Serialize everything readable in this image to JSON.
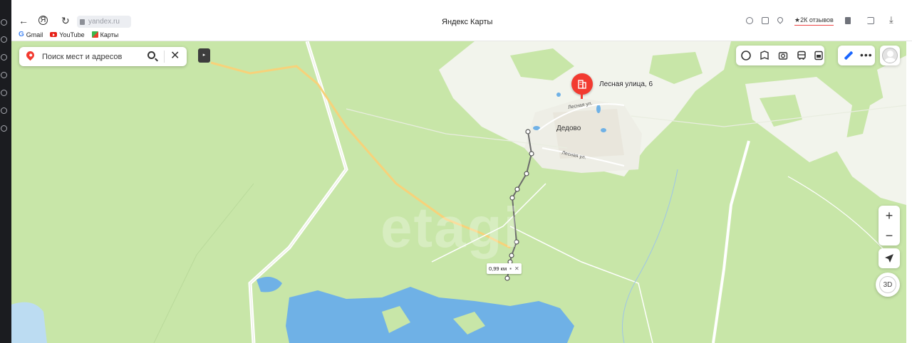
{
  "browser": {
    "url": "yandex.ru",
    "title": "Яндекс Карты",
    "reviews": "★2К отзывов",
    "bookmarks": [
      {
        "label": "Gmail"
      },
      {
        "label": "YouTube"
      },
      {
        "label": "Карты"
      }
    ]
  },
  "search": {
    "placeholder": "Поиск мест и адресов"
  },
  "map": {
    "place_label": "Лесная улица, 6",
    "village": "Дедово",
    "street_1": "Лесная ул.",
    "street_2": "Лесная ул.",
    "distance": "0,99 км",
    "watermark": "etagi"
  },
  "controls": {
    "zoom_in": "+",
    "zoom_out": "−",
    "view_3d": "3D"
  },
  "colors": {
    "forest": "#c8e6a8",
    "field": "#f2f4ec",
    "water": "#6fb1e6",
    "road": "#ffffff",
    "highway": "#f7d27a",
    "marker": "#f23a30"
  }
}
